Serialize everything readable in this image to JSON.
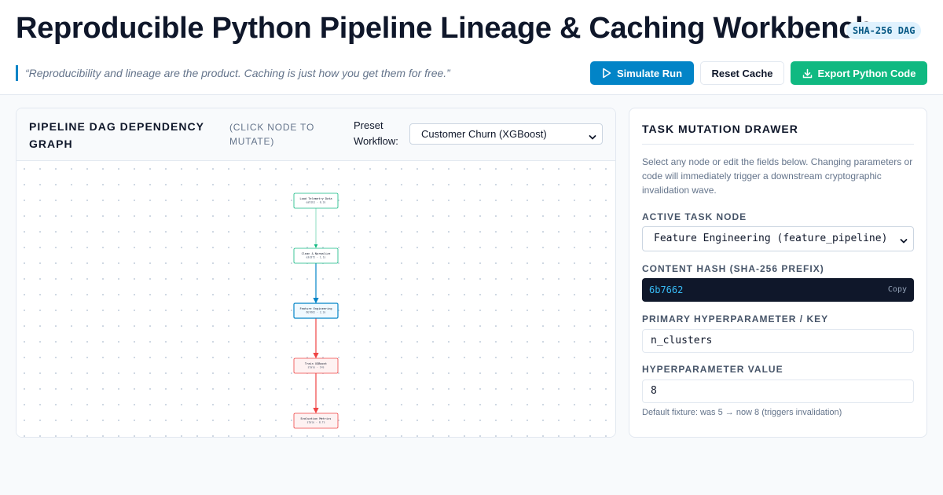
{
  "header": {
    "title": "Reproducible Python Pipeline Lineage & Caching Workbench",
    "badge": "SHA-256 DAG",
    "quote": "“Reproducibility and lineage are the product. Caching is just how you get them for free.”",
    "buttons": {
      "simulate": "Simulate Run",
      "reset": "Reset Cache",
      "export": "Export Python Code"
    }
  },
  "graph": {
    "title": "Pipeline DAG Dependency Graph",
    "hint": "(click node to mutate)",
    "preset_label": "Preset Workflow:",
    "preset_value": "Customer Churn (XGBoost)",
    "nodes": [
      {
        "label": "Load Telemetry Data",
        "meta": "ea91b1 · 0.3s",
        "status": "cached"
      },
      {
        "label": "Clean & Normalize",
        "meta": "a3c8f2 · 1.1s",
        "status": "cached"
      },
      {
        "label": "Feature Engineering",
        "meta": "6b7662 · 2.3s",
        "status": "active"
      },
      {
        "label": "Train XGBoost",
        "meta": "stale · 14s",
        "status": "invalidated"
      },
      {
        "label": "Evaluation Metrics",
        "meta": "stale · 0.7s",
        "status": "invalidated"
      }
    ],
    "colors": {
      "cached": "#10b981",
      "active": "#0284c7",
      "invalidated": "#ef4444"
    }
  },
  "drawer": {
    "title": "Task Mutation Drawer",
    "description": "Select any node or edit the fields below. Changing parameters or code will immediately trigger a downstream cryptographic invalidation wave.",
    "active_node_label": "Active Task Node",
    "active_node_value": "Feature Engineering (feature_pipeline)",
    "hash_label": "Content Hash (SHA-256 Prefix)",
    "hash_value": "6b7662",
    "copy_label": "Copy",
    "param_key_label": "Primary Hyperparameter / Key",
    "param_key_value": "n_clusters",
    "param_value_label": "Hyperparameter Value",
    "param_value": "8",
    "fixture_note": "Default fixture: was 5 → now 8 (triggers invalidation)"
  }
}
